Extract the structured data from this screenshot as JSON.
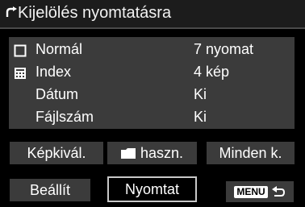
{
  "title": "Kijelölés nyomtatásra",
  "rows": [
    {
      "icon": "single-print-icon",
      "label": "Normál",
      "value": "7 nyomat"
    },
    {
      "icon": "index-print-icon",
      "label": "Index",
      "value": "4 kép"
    },
    {
      "icon": "",
      "label": "Dátum",
      "value": "Ki"
    },
    {
      "icon": "",
      "label": "Fájlszám",
      "value": "Ki"
    }
  ],
  "buttons": {
    "select_image": "Képkivál.",
    "folder": "haszn.",
    "all": "Minden k.",
    "setup": "Beállít",
    "print": "Nyomtat"
  },
  "menu_back": {
    "label": "MENU",
    "icon": "return-arrow-icon"
  }
}
